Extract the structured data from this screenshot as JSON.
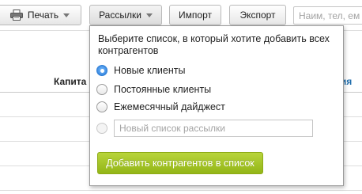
{
  "toolbar": {
    "print_label": "Печать",
    "mailing_label": "Рассылки",
    "import_label": "Импорт",
    "export_label": "Экспорт",
    "search_placeholder": "Наим, тел, ем"
  },
  "table": {
    "headers": [
      "Капита",
      "тия"
    ]
  },
  "dropdown": {
    "title": "Выберите список, в который хотите добавить всех контрагентов",
    "options": [
      {
        "label": "Новые клиенты",
        "selected": true
      },
      {
        "label": "Постоянные клиенты",
        "selected": false
      },
      {
        "label": "Ежемесячный дайджест",
        "selected": false
      }
    ],
    "new_list_placeholder": "Новый список рассылки",
    "submit_label": "Добавить контрагентов в список"
  },
  "colors": {
    "accent_green": "#a3c42a",
    "radio_blue": "#1f72d4",
    "link_blue": "#1f6dac"
  }
}
